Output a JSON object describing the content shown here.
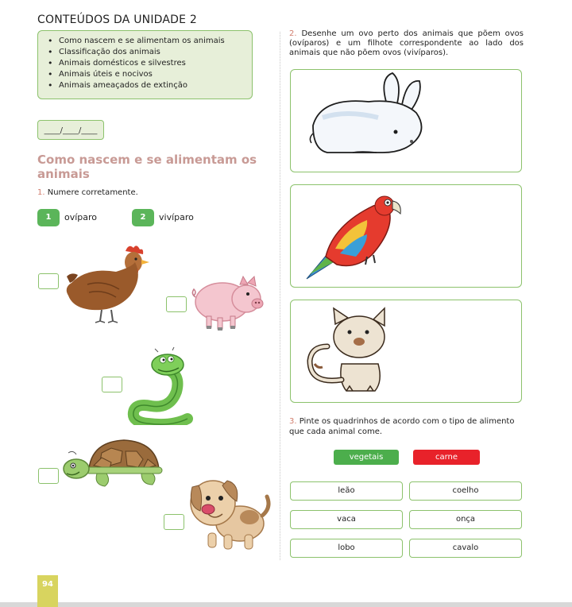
{
  "unit_title": "CONTEÚDOS DA UNIDADE 2",
  "topics": [
    "Como nascem e se alimentam os animais",
    "Classificação dos animais",
    "Animais domésticos e silvestres",
    "Animais úteis e nocivos",
    "Animais ameaçados de extinção"
  ],
  "date_placeholder": "____/____/____",
  "section_title": "Como nascem e se alimentam os animais",
  "question1": {
    "number": "1.",
    "text": "Numere corretamente.",
    "options": [
      {
        "badge": "1",
        "label": "ovíparo"
      },
      {
        "badge": "2",
        "label": "vivíparo"
      }
    ],
    "animals": [
      "galinha",
      "porco",
      "cobra",
      "tartaruga",
      "cachorro"
    ]
  },
  "question2": {
    "number": "2.",
    "text": "Desenhe um ovo perto dos animais que põem ovos (ovíparos) e um filhote correspondente ao lado dos animais que não põem ovos (vivíparos).",
    "animals": [
      "coelho",
      "arara",
      "gato"
    ]
  },
  "question3": {
    "number": "3.",
    "text": "Pinte os quadrinhos de acordo com o tipo de alimento que cada animal come.",
    "legend": {
      "vegetais": "vegetais",
      "carne": "carne"
    },
    "animals_left": [
      "leão",
      "vaca",
      "lobo"
    ],
    "animals_right": [
      "coelho",
      "onça",
      "cavalo"
    ]
  },
  "page_number": "94",
  "colors": {
    "green_border": "#8cc26c",
    "box_fill": "#e7efd9",
    "title_pink": "#c89a95",
    "badge_green": "#5bb55a",
    "veg_green": "#4cae4c",
    "meat_red": "#e8222a",
    "page_tab": "#d8d45f"
  }
}
